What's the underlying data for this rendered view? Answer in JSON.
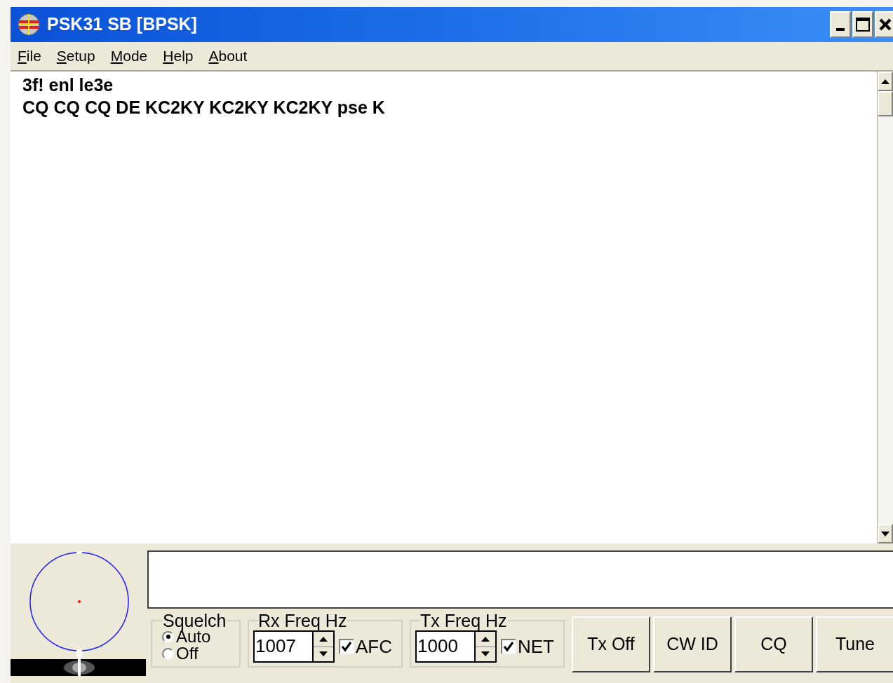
{
  "window": {
    "title": "PSK31 SB [BPSK]"
  },
  "menu": [
    "File",
    "Setup",
    "Mode",
    "Help",
    "About"
  ],
  "receive_text": [
    "3f! enl le3e",
    "CQ CQ CQ DE KC2KY KC2KY KC2KY pse K"
  ],
  "squelch": {
    "label": "Squelch",
    "options": [
      {
        "label": "Auto",
        "selected": true
      },
      {
        "label": "Off",
        "selected": false
      }
    ]
  },
  "rx_freq": {
    "label": "Rx Freq Hz",
    "value": "1007",
    "check": {
      "label": "AFC",
      "checked": true
    }
  },
  "tx_freq": {
    "label": "Tx Freq Hz",
    "value": "1000",
    "check": {
      "label": "NET",
      "checked": true
    }
  },
  "buttons": [
    "Tx Off",
    "CW ID",
    "CQ",
    "Tune"
  ]
}
